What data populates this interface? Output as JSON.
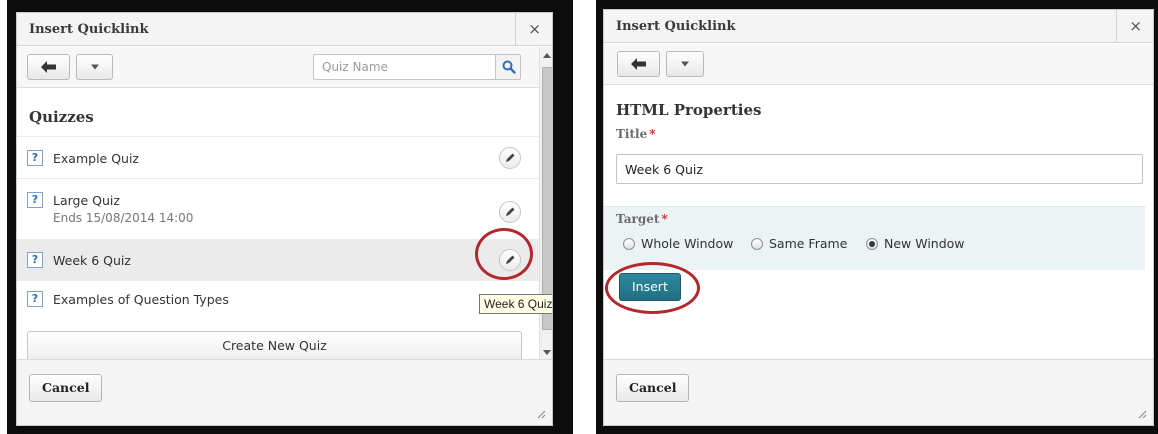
{
  "left_dialog": {
    "title": "Insert Quicklink",
    "close_label": "×",
    "search_placeholder": "Quiz Name",
    "section_title": "Quizzes",
    "items": [
      {
        "name": "Example Quiz",
        "sub": ""
      },
      {
        "name": "Large Quiz",
        "sub": "Ends 15/08/2014 14:00"
      },
      {
        "name": "Week 6 Quiz",
        "sub": ""
      },
      {
        "name": "Examples of Question Types",
        "sub": ""
      }
    ],
    "create_label": "Create New Quiz",
    "tooltip": "Week 6 Quiz",
    "cancel_label": "Cancel"
  },
  "right_dialog": {
    "title": "Insert Quicklink",
    "close_label": "×",
    "section_title": "HTML Properties",
    "title_label": "Title",
    "required_mark": "*",
    "title_value": "Week 6 Quiz",
    "target_label": "Target",
    "target_options": [
      {
        "label": "Whole Window",
        "checked": false
      },
      {
        "label": "Same Frame",
        "checked": false
      },
      {
        "label": "New Window",
        "checked": true
      }
    ],
    "insert_label": "Insert",
    "cancel_label": "Cancel"
  },
  "icons": {
    "back": "arrow-left-icon",
    "menu": "chevron-down-icon",
    "search": "magnifier-icon",
    "edit": "pencil-icon",
    "quiz": "question-mark-icon",
    "resize": "resize-grip-icon"
  },
  "colors": {
    "accent": "#1f6f83",
    "highlight_ring": "#b3282d",
    "required": "#d52a2a",
    "target_panel": "#ebf3f5"
  }
}
